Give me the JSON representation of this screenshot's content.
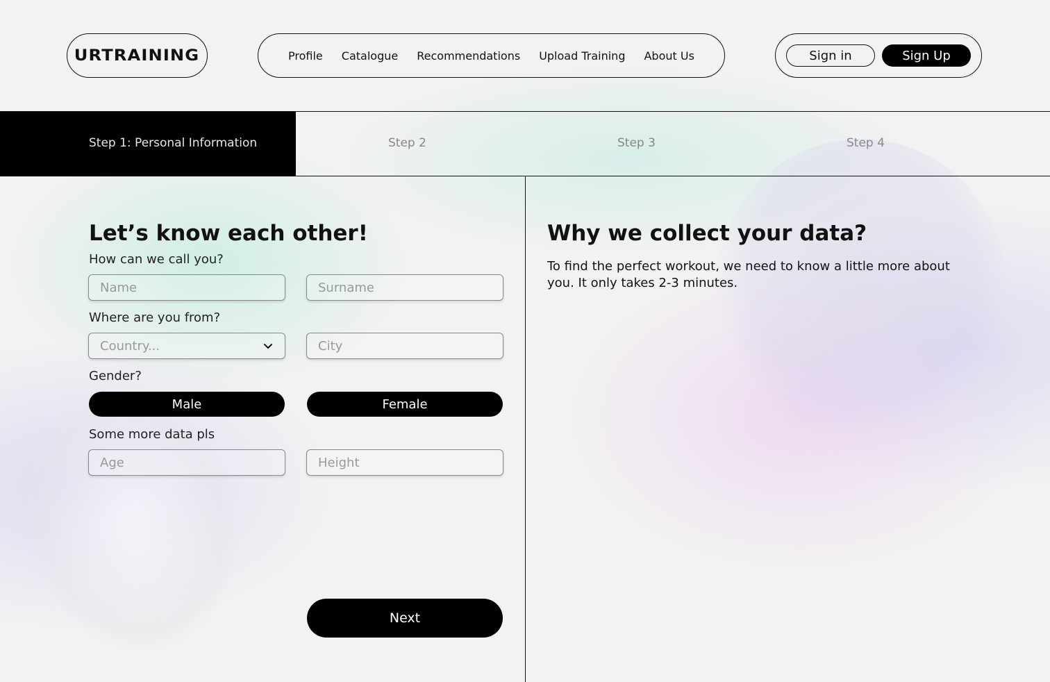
{
  "header": {
    "logo": "URTRAINING",
    "nav": [
      {
        "label": "Profile"
      },
      {
        "label": "Catalogue"
      },
      {
        "label": "Recommendations"
      },
      {
        "label": "Upload Training"
      },
      {
        "label": "About Us"
      }
    ],
    "sign_in": "Sign in",
    "sign_up": "Sign Up"
  },
  "steps": [
    {
      "label": "Step 1: Personal Information",
      "active": true
    },
    {
      "label": "Step 2",
      "active": false
    },
    {
      "label": "Step 3",
      "active": false
    },
    {
      "label": "Step 4",
      "active": false
    }
  ],
  "form": {
    "title": "Let’s know each other!",
    "name_question": "How can we call you?",
    "name_placeholder": "Name",
    "surname_placeholder": "Surname",
    "origin_question": "Where are you from?",
    "country_placeholder": "Country...",
    "city_placeholder": "City",
    "gender_question": "Gender?",
    "gender_male": "Male",
    "gender_female": "Female",
    "more_question": "Some more data pls",
    "age_placeholder": "Age",
    "height_placeholder": "Height",
    "next": "Next"
  },
  "info": {
    "title": "Why we collect your data?",
    "text": "To find the perfect workout, we need to know a little more about you. It only takes 2-3 minutes."
  },
  "colors": {
    "primary": "#000000",
    "background": "#f2f2f2",
    "mint_glow": "#b4ebdc",
    "lilac_glow": "#ebc8f0"
  },
  "icons": {
    "country_dropdown": "chevron-down-icon"
  }
}
